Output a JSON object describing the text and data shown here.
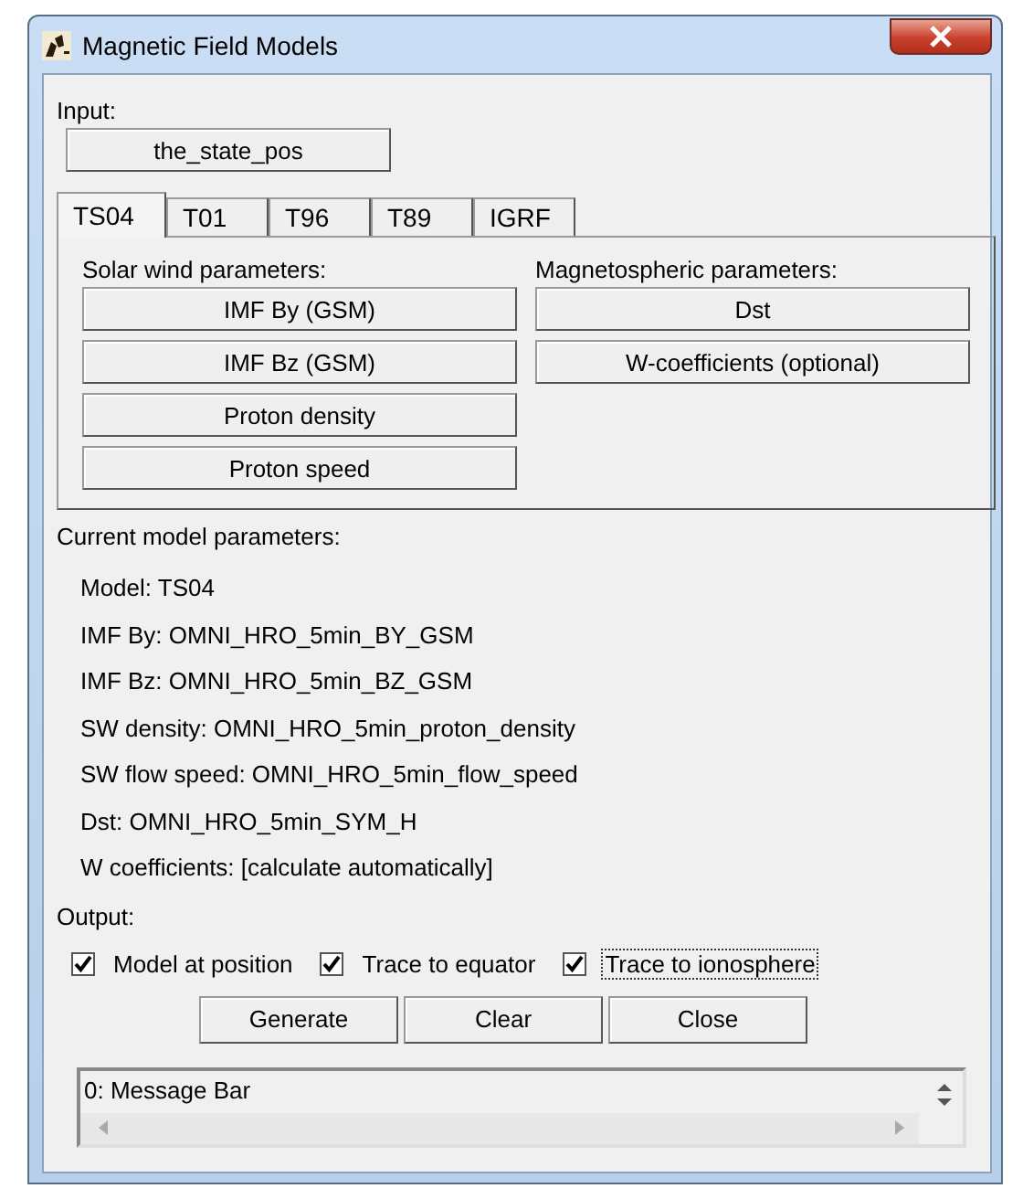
{
  "window": {
    "title": "Magnetic Field Models"
  },
  "input": {
    "label": "Input:",
    "button": "the_state_pos"
  },
  "tabs": [
    {
      "label": "TS04",
      "selected": true
    },
    {
      "label": "T01",
      "selected": false
    },
    {
      "label": "T96",
      "selected": false
    },
    {
      "label": "T89",
      "selected": false
    },
    {
      "label": "IGRF",
      "selected": false
    }
  ],
  "solar_wind": {
    "label": "Solar wind parameters:",
    "buttons": [
      "IMF By (GSM)",
      "IMF Bz (GSM)",
      "Proton density",
      "Proton speed"
    ]
  },
  "magnetospheric": {
    "label": "Magnetospheric parameters:",
    "buttons": [
      "Dst",
      "W-coefficients (optional)"
    ]
  },
  "current_parameters": {
    "label": "Current model parameters:",
    "lines": [
      "Model:  TS04",
      "IMF By:  OMNI_HRO_5min_BY_GSM",
      "IMF Bz:  OMNI_HRO_5min_BZ_GSM",
      "SW density:  OMNI_HRO_5min_proton_density",
      "SW flow speed:  OMNI_HRO_5min_flow_speed",
      "Dst:  OMNI_HRO_5min_SYM_H",
      "W coefficients:  [calculate automatically]"
    ]
  },
  "output": {
    "label": "Output:",
    "options": [
      {
        "label": "Model at position",
        "checked": true,
        "focused": false
      },
      {
        "label": "Trace to equator",
        "checked": true,
        "focused": false
      },
      {
        "label": "Trace to ionosphere",
        "checked": true,
        "focused": true
      }
    ]
  },
  "buttons": [
    "Generate",
    "Clear",
    "Close"
  ],
  "message_bar": {
    "text": "0: Message Bar"
  }
}
